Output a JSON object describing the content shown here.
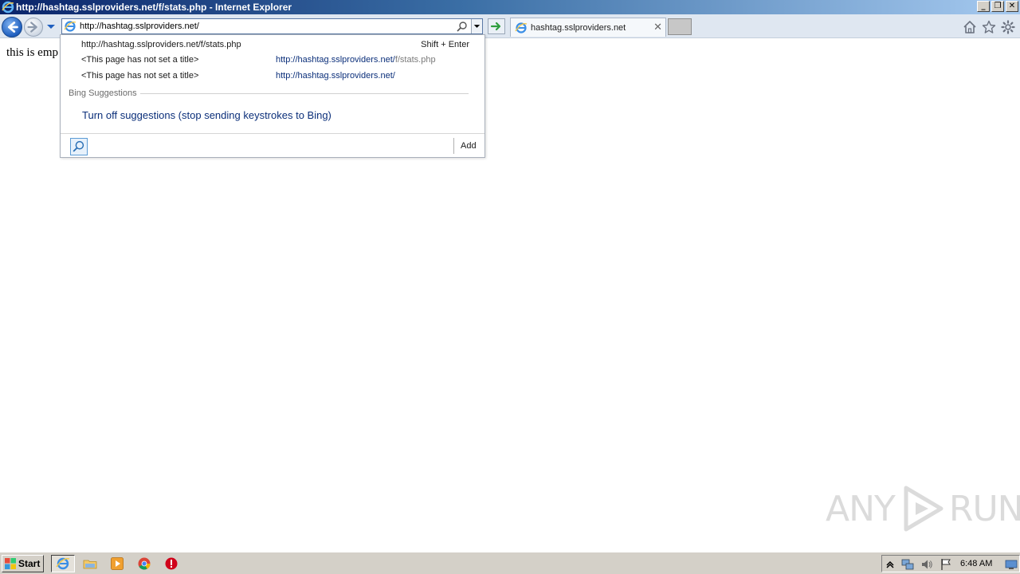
{
  "window": {
    "title": "http://hashtag.sslproviders.net/f/stats.php - Internet Explorer",
    "controls": {
      "minimize": "_",
      "restore": "❐",
      "close": "✕"
    }
  },
  "address_bar": {
    "value": "http://hashtag.sslproviders.net/"
  },
  "tab": {
    "label": "hashtag.sslproviders.net",
    "close": "✕"
  },
  "page": {
    "text": "this is emp"
  },
  "dropdown": {
    "top_row": {
      "url": "http://hashtag.sslproviders.net/f/stats.php",
      "shortcut": "Shift + Enter"
    },
    "history": [
      {
        "title": "<This page has not set a title>",
        "url_main": "http://hashtag.sslproviders.net/",
        "url_dim": "f/stats.php"
      },
      {
        "title": "<This page has not set a title>",
        "url_main": "http://hashtag.sslproviders.net/",
        "url_dim": ""
      }
    ],
    "section_label": "Bing Suggestions",
    "suggestion": "Turn off suggestions (stop sending keystrokes to Bing)",
    "add_label": "Add"
  },
  "taskbar": {
    "start_label": "Start",
    "clock": "6:48 AM"
  },
  "watermark": {
    "left": "ANY",
    "right": "RUN"
  },
  "icons": {
    "back": "back-arrow-icon",
    "forward": "forward-arrow-icon",
    "home": "home-icon",
    "favorites": "star-icon",
    "tools": "gear-icon"
  },
  "colors": {
    "title_bar_start": "#0a246a",
    "link_blue": "#0b2f7a",
    "go_green": "#2e9e3e"
  }
}
